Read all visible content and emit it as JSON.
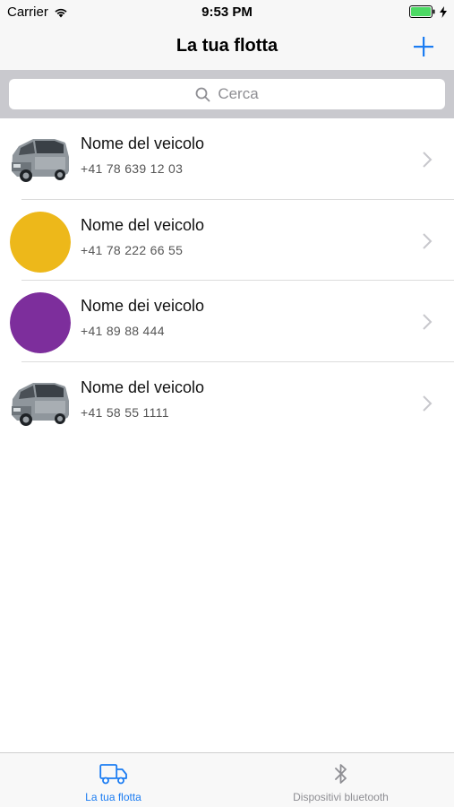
{
  "status_bar": {
    "carrier": "Carrier",
    "time": "9:53 PM"
  },
  "nav": {
    "title": "La tua flotta",
    "add_icon": "plus-icon"
  },
  "search": {
    "placeholder": "Cerca"
  },
  "vehicles": [
    {
      "name": "Nome del veicolo",
      "phone": "+41 78 639 12 03",
      "avatar": "van-photo"
    },
    {
      "name": "Nome del veicolo",
      "phone": "+41 78 222 66 55",
      "avatar": "circle",
      "color": "#EDB81A"
    },
    {
      "name": "Nome dei veicolo",
      "phone": "+41 89 88 444",
      "avatar": "circle",
      "color": "#7D2E9C"
    },
    {
      "name": "Nome del veicolo",
      "phone": "+41 58 55 1111",
      "avatar": "van-photo"
    }
  ],
  "tab_bar": {
    "tabs": [
      {
        "label": "La tua flotta",
        "icon": "truck-icon",
        "active": true
      },
      {
        "label": "Dispositivi bluetooth",
        "icon": "bluetooth-icon",
        "active": false
      }
    ]
  },
  "colors": {
    "accent": "#1B7CF2",
    "battery": "#4CD964"
  }
}
